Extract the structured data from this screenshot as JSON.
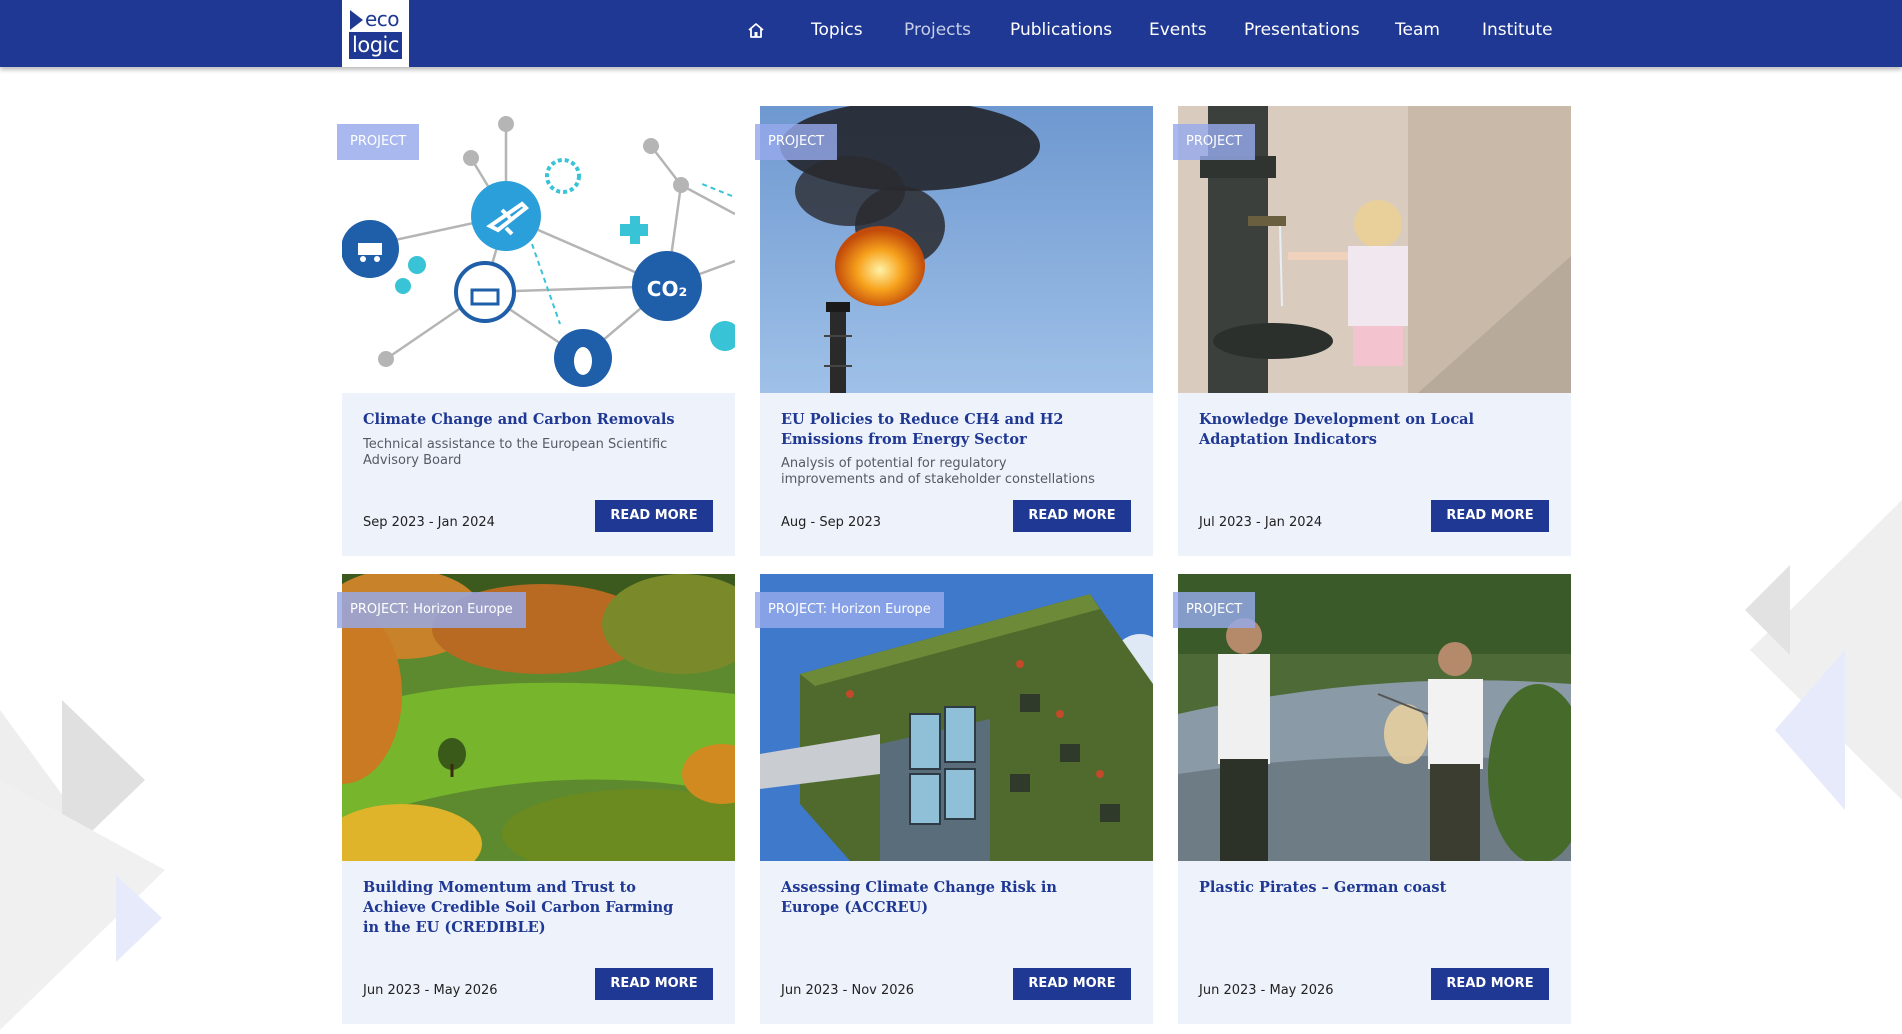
{
  "logo": {
    "line1": "eco",
    "line2": "logic"
  },
  "nav": {
    "home_icon": "home-icon",
    "items": [
      {
        "label": "Topics",
        "active": false
      },
      {
        "label": "Projects",
        "active": true
      },
      {
        "label": "Publications",
        "active": false
      },
      {
        "label": "Events",
        "active": false
      },
      {
        "label": "Presentations",
        "active": false
      },
      {
        "label": "Team",
        "active": false
      },
      {
        "label": "Institute",
        "active": false
      }
    ]
  },
  "colors": {
    "brand": "#1f3893",
    "card_bg": "#eef2fb",
    "tag_bg": "#96aaeb"
  },
  "cards": [
    {
      "tag": "PROJECT",
      "title": "Climate Change and Carbon Removals",
      "subtitle": "Technical assistance to the European Scientific Advisory Board",
      "date": "Sep 2023 - Jan 2024",
      "button": "READ MORE",
      "image": "network-of-climate-icons"
    },
    {
      "tag": "PROJECT",
      "title": "EU Policies to Reduce CH4 and H2 Emissions from Energy Sector",
      "subtitle": "Analysis of potential for regulatory improvements and of stakeholder constellations",
      "date": "Aug - Sep 2023",
      "button": "READ MORE",
      "image": "gas-flare-stack"
    },
    {
      "tag": "PROJECT",
      "title": "Knowledge Development on Local Adaptation Indicators",
      "subtitle": "",
      "date": "Jul 2023 - Jan 2024",
      "button": "READ MORE",
      "image": "girl-at-water-fountain"
    },
    {
      "tag": "PROJECT:  Horizon Europe",
      "title": "Building Momentum and Trust to Achieve Credible Soil Carbon Farming in the EU (CREDIBLE)",
      "subtitle": "",
      "date": "Jun 2023 - May 2026",
      "button": "READ MORE",
      "image": "autumn-forest-meadow"
    },
    {
      "tag": "PROJECT:  Horizon Europe",
      "title": "Assessing Climate Change Risk in Europe (ACCREU)",
      "subtitle": "",
      "date": "Jun 2023 - Nov 2026",
      "button": "READ MORE",
      "image": "green-facade-building"
    },
    {
      "tag": "PROJECT",
      "title": "Plastic Pirates – German coast",
      "subtitle": "",
      "date": "Jun 2023 - May 2026",
      "button": "READ MORE",
      "image": "kids-sampling-river"
    }
  ]
}
